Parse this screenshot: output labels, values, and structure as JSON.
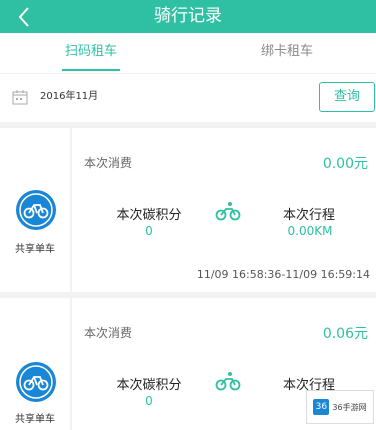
{
  "header": {
    "title": "骑行记录"
  },
  "tabs": [
    {
      "label": "扫码租车",
      "active": true
    },
    {
      "label": "绑卡租车",
      "active": false
    }
  ],
  "filter": {
    "date": "2016年11月",
    "query_label": "查询"
  },
  "records": [
    {
      "brand": "共享单车",
      "cost_label": "本次消费",
      "cost_value": "0.00元",
      "carbon_label": "本次碳积分",
      "carbon_value": "0",
      "trip_label": "本次行程",
      "trip_value": "0.00KM",
      "time_range": "11/09 16:58:36-11/09 16:59:14"
    },
    {
      "brand": "共享单车",
      "cost_label": "本次消费",
      "cost_value": "0.06元",
      "carbon_label": "本次碳积分",
      "carbon_value": "0",
      "trip_label": "本次行程",
      "trip_value": ""
    }
  ],
  "watermark": {
    "logo": "36",
    "text": "36手游网"
  },
  "colors": {
    "accent": "#2fc0a4",
    "brand_blue": "#1a86d6"
  }
}
